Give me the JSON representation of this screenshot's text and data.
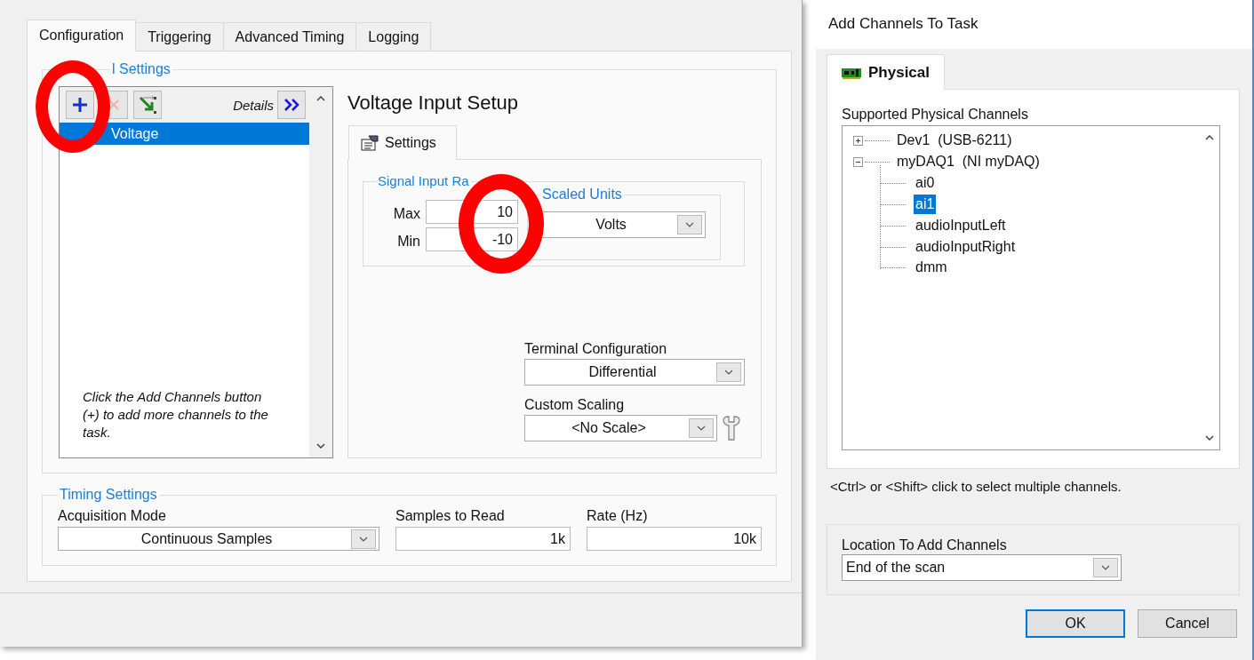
{
  "main_window": {
    "tabs": [
      {
        "label": "Configuration",
        "selected": true
      },
      {
        "label": "Triggering",
        "selected": false
      },
      {
        "label": "Advanced Timing",
        "selected": false
      },
      {
        "label": "Logging",
        "selected": false
      }
    ],
    "channel_settings": {
      "legend": "l Settings",
      "details_label": "Details",
      "channels": [
        {
          "name": "Voltage",
          "selected": true
        }
      ],
      "hint": "Click the Add Channels button (+) to add more channels to the task."
    },
    "setup": {
      "title": "Voltage Input Setup",
      "tabs": [
        {
          "label": "Settings",
          "selected": true
        }
      ],
      "signal_input_range": {
        "legend": "Signal Input Ra",
        "max_label": "Max",
        "max_value": "10",
        "min_label": "Min",
        "min_value": "-10"
      },
      "scaled_units": {
        "legend": "Scaled Units",
        "value": "Volts"
      },
      "terminal_configuration": {
        "label": "Terminal Configuration",
        "value": "Differential"
      },
      "custom_scaling": {
        "label": "Custom Scaling",
        "value": "<No Scale>"
      }
    },
    "timing_settings": {
      "legend": "Timing Settings",
      "acquisition_mode": {
        "label": "Acquisition Mode",
        "value": "Continuous Samples"
      },
      "samples_to_read": {
        "label": "Samples to Read",
        "value": "1k"
      },
      "rate": {
        "label": "Rate (Hz)",
        "value": "10k"
      }
    }
  },
  "dialog": {
    "title": "Add Channels To Task",
    "tabs": [
      {
        "label": "Physical",
        "selected": true
      }
    ],
    "tree_label": "Supported Physical Channels",
    "tree": [
      {
        "label": "Dev1  (USB-6211)",
        "expanded": false,
        "selected": false
      },
      {
        "label": "myDAQ1  (NI myDAQ)",
        "expanded": true,
        "selected": false,
        "children": [
          {
            "label": "ai0",
            "selected": false
          },
          {
            "label": "ai1",
            "selected": true
          },
          {
            "label": "audioInputLeft",
            "selected": false
          },
          {
            "label": "audioInputRight",
            "selected": false
          },
          {
            "label": "dmm",
            "selected": false
          }
        ]
      }
    ],
    "hint": "<Ctrl> or <Shift> click to select multiple channels.",
    "location": {
      "label": "Location To Add Channels",
      "value": "End of the scan"
    },
    "buttons": [
      {
        "label": "OK",
        "default": true
      },
      {
        "label": "Cancel",
        "default": false
      }
    ]
  },
  "annotations": [
    {
      "kind": "circle"
    },
    {
      "kind": "circle"
    }
  ]
}
